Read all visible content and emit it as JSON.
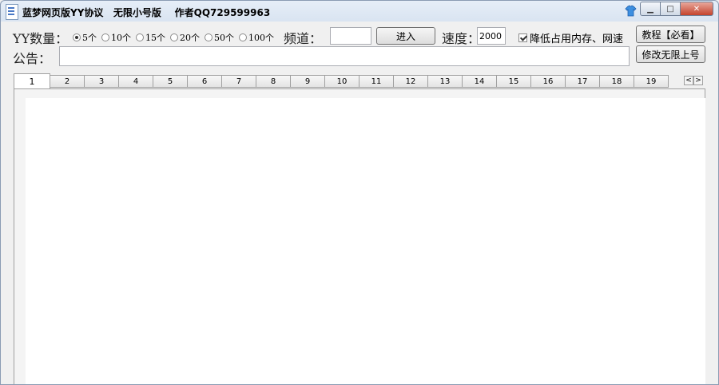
{
  "window": {
    "title": "蓝梦网页版YY协议   无限小号版    作者QQ729599963",
    "controls": {
      "min": "▁",
      "max": "□",
      "close": "✕"
    }
  },
  "toolbar": {
    "yy_count_label": "YY数量：",
    "yy_options": [
      "5个",
      "10个",
      "15个",
      "20个",
      "50个",
      "100个"
    ],
    "yy_selected": "5个",
    "channel_label": "频道：",
    "channel_value": "",
    "enter_button": "进入",
    "speed_label": "速度：",
    "speed_value": "2000",
    "reduce_checkbox_label": "降低占用内存、网速",
    "reduce_checked": true,
    "tutorial_button": "教程【必看】",
    "notice_label": "公告：",
    "notice_value": "",
    "modify_button": "修改无限上号"
  },
  "tabs": {
    "items": [
      "1",
      "2",
      "3",
      "4",
      "5",
      "6",
      "7",
      "8",
      "9",
      "10",
      "11",
      "12",
      "13",
      "14",
      "15",
      "16",
      "17",
      "18",
      "19"
    ],
    "active": "1",
    "scroll_left": "<",
    "scroll_right": ">"
  },
  "icons": {
    "app": "app-document-icon",
    "caption": "cap-icon"
  },
  "colors": {
    "close_button": "#c4442d",
    "titlebar": "#d9e4f1"
  }
}
